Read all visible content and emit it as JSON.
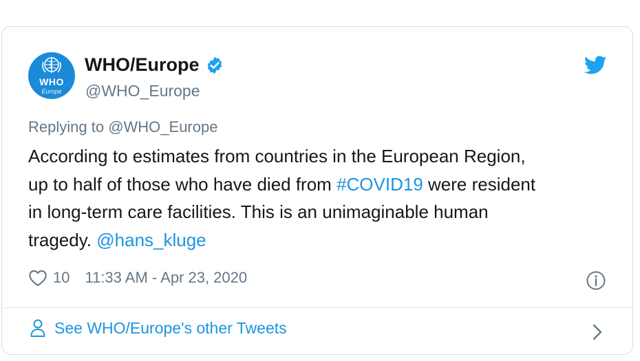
{
  "account": {
    "display_name": "WHO/Europe",
    "handle": "@WHO_Europe",
    "avatar_text": "WHO",
    "avatar_subtext": "Europe",
    "verified": true
  },
  "reply": {
    "prefix": "Replying to ",
    "mention": "@WHO_Europe"
  },
  "tweet": {
    "line1": "According to estimates from countries in the European Region,",
    "line2_before": "up to half of those who have died from ",
    "hashtag": "#COVID19",
    "line2_after": " were resident",
    "line3": "in long-term care facilities. This is an unimaginable human",
    "line4_before": "tragedy. ",
    "mention": "@hans_kluge"
  },
  "meta": {
    "like_count": "10",
    "timestamp": "11:33 AM - Apr 23, 2020"
  },
  "footer": {
    "link_label": "See WHO/Europe's other Tweets"
  },
  "icons": {
    "brand": "twitter-bird-icon",
    "verified": "verified-badge-icon",
    "like": "heart-icon",
    "info": "info-icon",
    "profile": "person-icon",
    "chevron": "chevron-right-icon"
  },
  "colors": {
    "accent": "#1b95e0",
    "text": "#14171a",
    "secondary": "#657786",
    "avatar_bg": "#1b8ad8"
  }
}
